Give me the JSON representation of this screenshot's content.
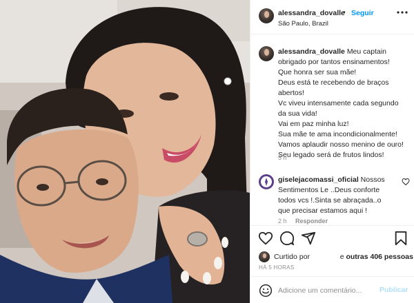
{
  "post": {
    "author": {
      "username": "alessandra_dovalle",
      "separator": "•",
      "follow_label": "Seguir",
      "location": "São Paulo, Brazil"
    },
    "caption": {
      "username": "alessandra_dovalle",
      "lines": [
        "Meu captain",
        "obrigado por tantos ensinamentos!",
        "Que honra ser sua mãe!",
        "Deus está te recebendo de braços",
        "abertos!",
        "Vc viveu intensamente cada segundo",
        "da sua vida!",
        "Vai em paz minha luz!",
        "Sua mãe te ama incondicionalmente!",
        "Vamos aplaudir nosso menino de ouro!",
        "Seu legado será de frutos lindos!"
      ],
      "time": "5 h"
    },
    "comments": [
      {
        "username": "giselejacomassi_oficial",
        "lines": [
          "Nossos",
          "Sentimentos Le ..Deus conforte",
          "todos vcs !.Sinta se abraçada..o",
          "que precisar estamos aqui !"
        ],
        "time": "2 h",
        "reply_label": "Responder"
      }
    ],
    "likes": {
      "prefix": "Curtido por",
      "middle": "e",
      "others": "outras 406 pessoas"
    },
    "timestamp": "HÁ 5 HORAS",
    "add_comment": {
      "placeholder": "Adicione um comentário...",
      "publish_label": "Publicar"
    }
  },
  "icons": {
    "more": "more-options-icon",
    "like": "heart-icon",
    "comment": "comment-icon",
    "share": "share-icon",
    "save": "bookmark-icon",
    "emoji": "emoji-icon",
    "comment_like": "small-heart-icon"
  },
  "colors": {
    "accent": "#0095f6",
    "muted": "#8e8e8e",
    "publish_disabled": "#b2dffc"
  }
}
